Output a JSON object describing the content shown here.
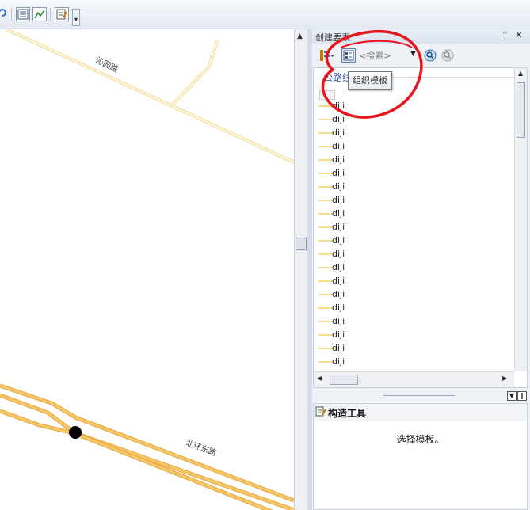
{
  "map": {
    "labels": [
      "沁园路",
      "北环东路"
    ]
  },
  "panel": {
    "title": "创建要素",
    "pin_glyph": "ᛘ",
    "close_glyph": "✕",
    "toolbar": {
      "search_placeholder": "<搜索>",
      "organize_tooltip": "组织模板"
    },
    "group_header": "公路线",
    "templates": [
      "diji",
      "diji",
      "diji",
      "diji",
      "diji",
      "diji",
      "diji",
      "diji",
      "diji",
      "diji",
      "diji",
      "diji",
      "diji",
      "diji",
      "diji",
      "diji",
      "diji",
      "diji",
      "diji",
      "diji"
    ],
    "construction_tools": {
      "title": "构造工具",
      "message": "选择模板。"
    }
  },
  "colors": {
    "road_outline": "#e6a63a",
    "road_fill": "#f6c86a",
    "minor_road": "#f5e5a0",
    "annotation": "#e8141c",
    "panel_bg": "#eef1f6"
  },
  "icons": [
    "rotate-icon",
    "table-icon",
    "chart-icon",
    "editor-icon",
    "overflow-icon",
    "template-properties-icon",
    "organize-templates-icon",
    "search-icon",
    "clear-search-icon",
    "pin-icon",
    "close-icon",
    "construction-tools-icon"
  ]
}
